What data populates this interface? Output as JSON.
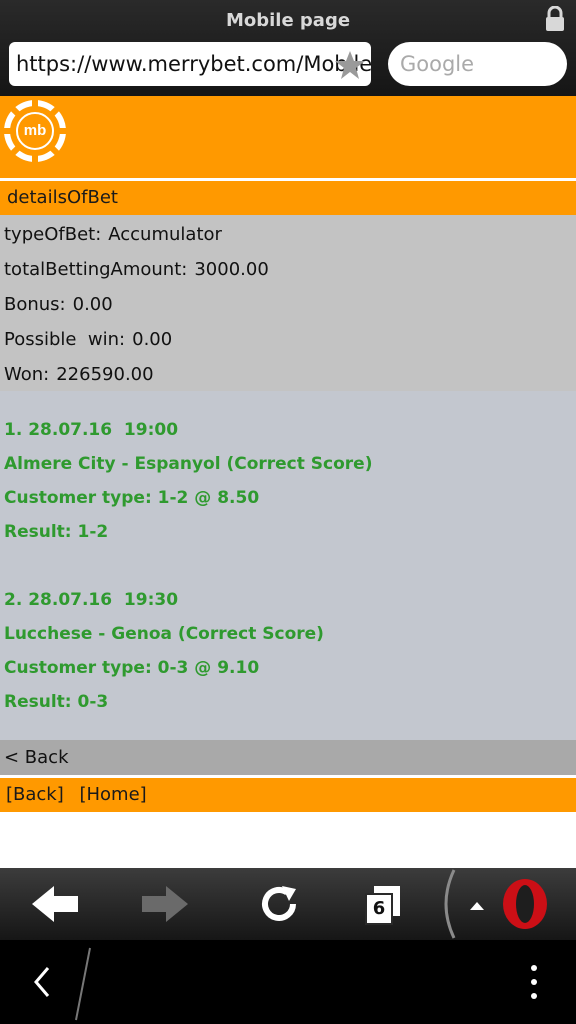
{
  "browser": {
    "title": "Mobile page",
    "url": "https://www.merrybet.com/Mobile",
    "search_placeholder": "Google",
    "tab_count": "6"
  },
  "site": {
    "logo_text": "mb"
  },
  "details": {
    "header": "detailsOfBet",
    "rows": [
      {
        "label": "typeOfBet:",
        "value": "Accumulator"
      },
      {
        "label": "totalBettingAmount:",
        "value": "3000.00"
      },
      {
        "label": "Bonus:",
        "value": "0.00"
      },
      {
        "label": "Possible  win:",
        "value": "0.00"
      },
      {
        "label": "Won:",
        "value": "226590.00"
      }
    ]
  },
  "bets": [
    {
      "datetime": "1. 28.07.16  19:00",
      "match": "Almere City - Espanyol (Correct Score)",
      "customer": "Customer type: 1-2 @ 8.50",
      "result": "Result: 1-2"
    },
    {
      "datetime": "2. 28.07.16  19:30",
      "match": "Lucchese - Genoa (Correct Score)",
      "customer": "Customer type: 0-3 @ 9.10",
      "result": "Result: 0-3"
    }
  ],
  "nav": {
    "back": "< Back",
    "footer_back": "[Back]",
    "footer_home": "[Home]"
  },
  "colors": {
    "brand_orange": "#ff9900",
    "bet_green": "#2f9a2f",
    "opera_red": "#cc0f16"
  },
  "icons": [
    "lock-icon",
    "star-icon",
    "back-arrow-icon",
    "forward-arrow-icon",
    "reload-icon",
    "tabs-icon",
    "opera-icon",
    "system-back-icon",
    "overflow-menu-icon"
  ]
}
